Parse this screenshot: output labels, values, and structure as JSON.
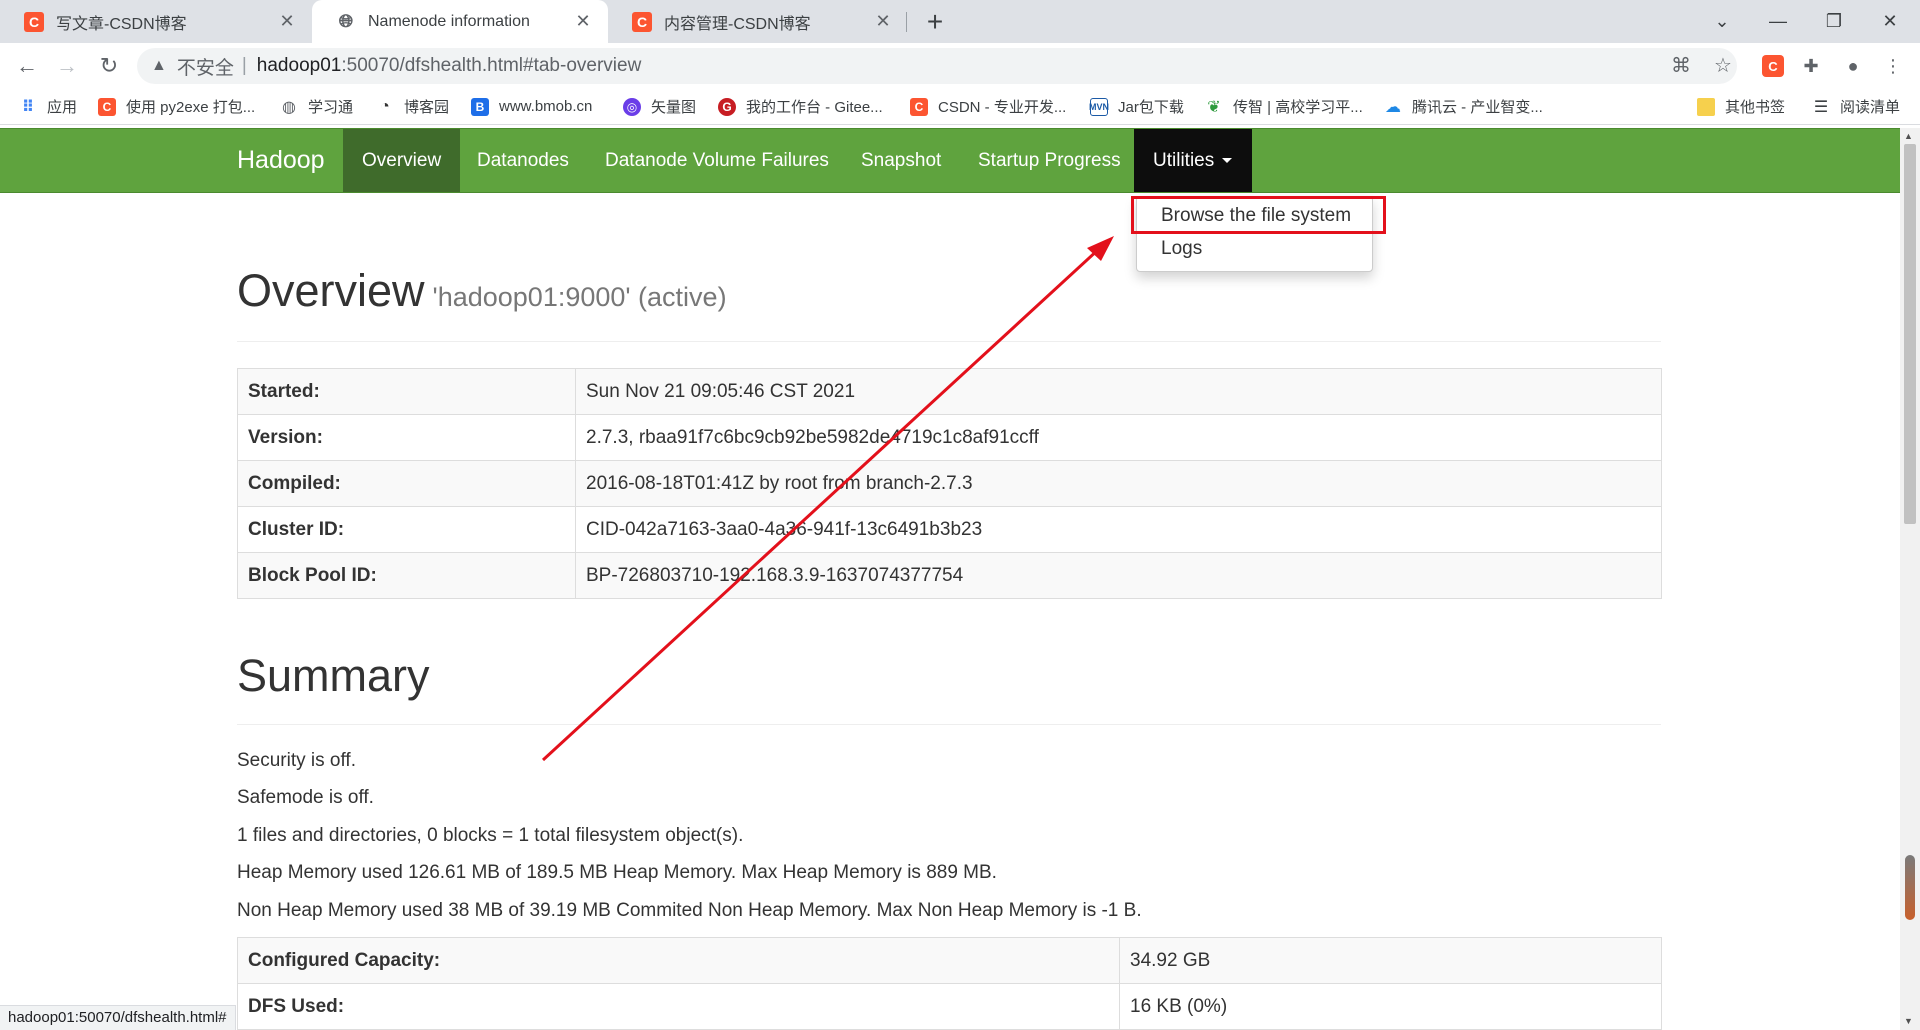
{
  "browser": {
    "tabs": [
      {
        "title": "写文章-CSDN博客",
        "icon": "csdn-icon",
        "active": false
      },
      {
        "title": "Namenode information",
        "icon": "globe-icon",
        "active": true
      },
      {
        "title": "内容管理-CSDN博客",
        "icon": "csdn-icon",
        "active": false
      }
    ],
    "new_tab_label": "+",
    "address": {
      "insecure_label": "不安全",
      "host": "hadoop01",
      "path": ":50070/dfshealth.html#tab-overview"
    },
    "bookmarks": [
      {
        "label": "应用",
        "icon": "apps-grid-icon"
      },
      {
        "label": "使用 py2exe 打包...",
        "icon": "csdn-icon"
      },
      {
        "label": "学习通",
        "icon": "globe-icon"
      },
      {
        "label": "博客园",
        "icon": "cnblogs-icon"
      },
      {
        "label": "www.bmob.cn",
        "icon": "bmob-icon"
      },
      {
        "label": "矢量图",
        "icon": "iconfont-icon"
      },
      {
        "label": "我的工作台 - Gitee...",
        "icon": "gitee-icon"
      },
      {
        "label": "CSDN - 专业开发...",
        "icon": "csdn-icon"
      },
      {
        "label": "Jar包下载",
        "icon": "mvn-icon"
      },
      {
        "label": "传智 | 高校学习平...",
        "icon": "chuanzhi-icon"
      },
      {
        "label": "腾讯云 - 产业智变...",
        "icon": "tencent-cloud-icon"
      },
      {
        "label": "其他书签",
        "icon": "folder-icon"
      },
      {
        "label": "阅读清单",
        "icon": "reading-list-icon"
      }
    ],
    "status_url": "hadoop01:50070/dfshealth.html#"
  },
  "navbar": {
    "brand": "Hadoop",
    "items": [
      {
        "label": "Overview",
        "active": true
      },
      {
        "label": "Datanodes",
        "active": false
      },
      {
        "label": "Datanode Volume Failures",
        "active": false
      },
      {
        "label": "Snapshot",
        "active": false
      },
      {
        "label": "Startup Progress",
        "active": false
      }
    ],
    "utilities": {
      "label": "Utilities",
      "menu": [
        "Browse the file system",
        "Logs"
      ]
    },
    "color": "#5fa33e"
  },
  "overview": {
    "title": "Overview",
    "subtitle": "'hadoop01:9000' (active)",
    "rows": [
      {
        "key": "Started:",
        "value": "Sun Nov 21 09:05:46 CST 2021"
      },
      {
        "key": "Version:",
        "value": "2.7.3, rbaa91f7c6bc9cb92be5982de4719c1c8af91ccff"
      },
      {
        "key": "Compiled:",
        "value": "2016-08-18T01:41Z by root from branch-2.7.3"
      },
      {
        "key": "Cluster ID:",
        "value": "CID-042a7163-3aa0-4a36-941f-13c6491b3b23"
      },
      {
        "key": "Block Pool ID:",
        "value": "BP-726803710-192.168.3.9-1637074377754"
      }
    ]
  },
  "summary": {
    "title": "Summary",
    "lines": [
      "Security is off.",
      "Safemode is off.",
      "1 files and directories, 0 blocks = 1 total filesystem object(s).",
      "Heap Memory used 126.61 MB of 189.5 MB Heap Memory. Max Heap Memory is 889 MB.",
      "Non Heap Memory used 38 MB of 39.19 MB Commited Non Heap Memory. Max Non Heap Memory is -1 B."
    ],
    "rows": [
      {
        "key": "Configured Capacity:",
        "value": "34.92 GB"
      },
      {
        "key": "DFS Used:",
        "value": "16 KB (0%)"
      }
    ]
  },
  "annotation_color": "#e3101b"
}
